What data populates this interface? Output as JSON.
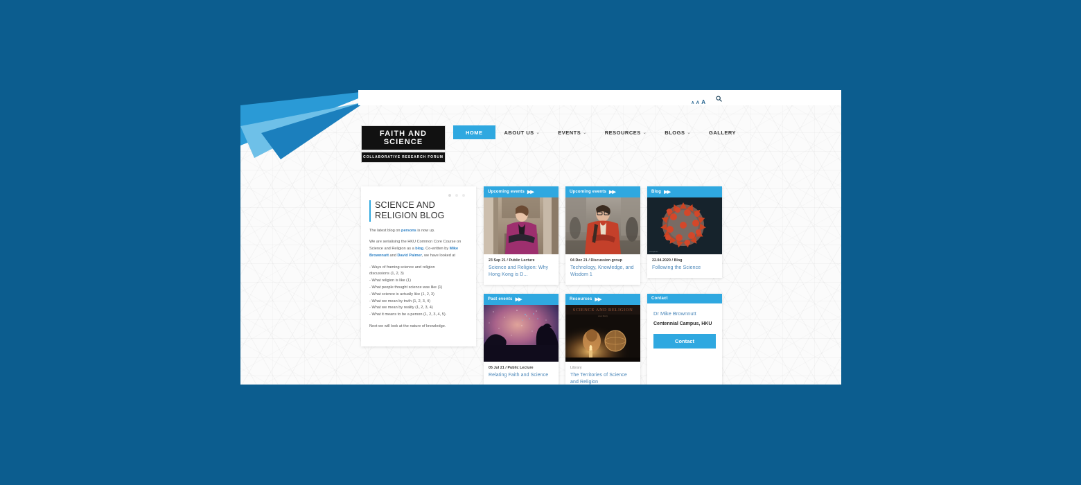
{
  "site": {
    "logo_line1": "FAITH AND SCIENCE",
    "logo_line2": "COLLABORATIVE RESEARCH FORUM"
  },
  "utility": {
    "font_small": "A",
    "font_medium": "A",
    "font_large": "A",
    "search_icon": "search-icon"
  },
  "nav": {
    "items": [
      {
        "label": "HOME",
        "caret": "",
        "active": true
      },
      {
        "label": "ABOUT US",
        "caret": "⌄",
        "active": false
      },
      {
        "label": "EVENTS",
        "caret": "⌄",
        "active": false
      },
      {
        "label": "RESOURCES",
        "caret": "⌄",
        "active": false
      },
      {
        "label": "BLOGS",
        "caret": "⌄",
        "active": false
      },
      {
        "label": "GALLERY",
        "caret": "",
        "active": false
      }
    ]
  },
  "blog_panel": {
    "title": "SCIENCE AND RELIGION BLOG",
    "intro_a": "The latest blog on ",
    "intro_link": "persons",
    "intro_b": " is now up.",
    "para2_a": "We are serialising the HKU Common Core Course on Science and Religion as a ",
    "para2_link": "blog",
    "para2_b": ". Co-written by ",
    "para2_link2": "Mike Brownnutt",
    "para2_c": " and ",
    "para2_link3": "David Palmer",
    "para2_d": ", we have looked at",
    "bullets": [
      "- Ways of framing science and religion",
      "discussions (1, 2, 3)",
      "- What religion is like (1)",
      "- What people thought science was like (1)",
      "- What science is actually like (1, 2, 3)",
      "- What we mean by truth (1, 2, 3, 4)",
      "- What we mean by reality (1, 2, 3, 4)",
      "- What it means to be a person (1, 2, 3, 4, 5)."
    ],
    "closing": "Next we will look at the nature of knowledge."
  },
  "cards": [
    {
      "caption": "Upcoming events",
      "arrows": "▶▶",
      "meta": "23 Sep 21  /  Public Lecture",
      "title": "Science and Religion: Why Hong Kong is D...",
      "thumb": "woman-in-magenta-blazer-photo"
    },
    {
      "caption": "Upcoming events",
      "arrows": "▶▶",
      "meta": "04 Dec 21  /  Discussion group",
      "title": "Technology, Knowledge, and Wisdom 1",
      "thumb": "man-in-red-jacket-photo"
    },
    {
      "caption": "Blog",
      "arrows": "▶▶",
      "meta": "22.04.2020  /  Blog",
      "title": "Following the Science",
      "thumb": "coronavirus-particle-photo"
    },
    {
      "caption": "Past events",
      "arrows": "▶▶",
      "meta": "05 Jul 21  /  Public Lecture",
      "title": "Relating Faith and Science",
      "thumb": "galaxy-silhouette-photo"
    },
    {
      "caption": "Resources",
      "arrows": "▶▶",
      "meta": "Library",
      "title": "The Territories of Science and Religion",
      "thumb": "book-cover-science-and-religion"
    }
  ],
  "contact": {
    "caption": "Contact",
    "name": "Dr Mike Brownnutt",
    "address": "Centennial Campus, HKU",
    "button": "Contact"
  },
  "colors": {
    "accent_blue": "#2fa8e0",
    "deep_blue": "#0c5d8f",
    "link_blue": "#4a86b8",
    "page_bg": "#fbfbfb"
  }
}
